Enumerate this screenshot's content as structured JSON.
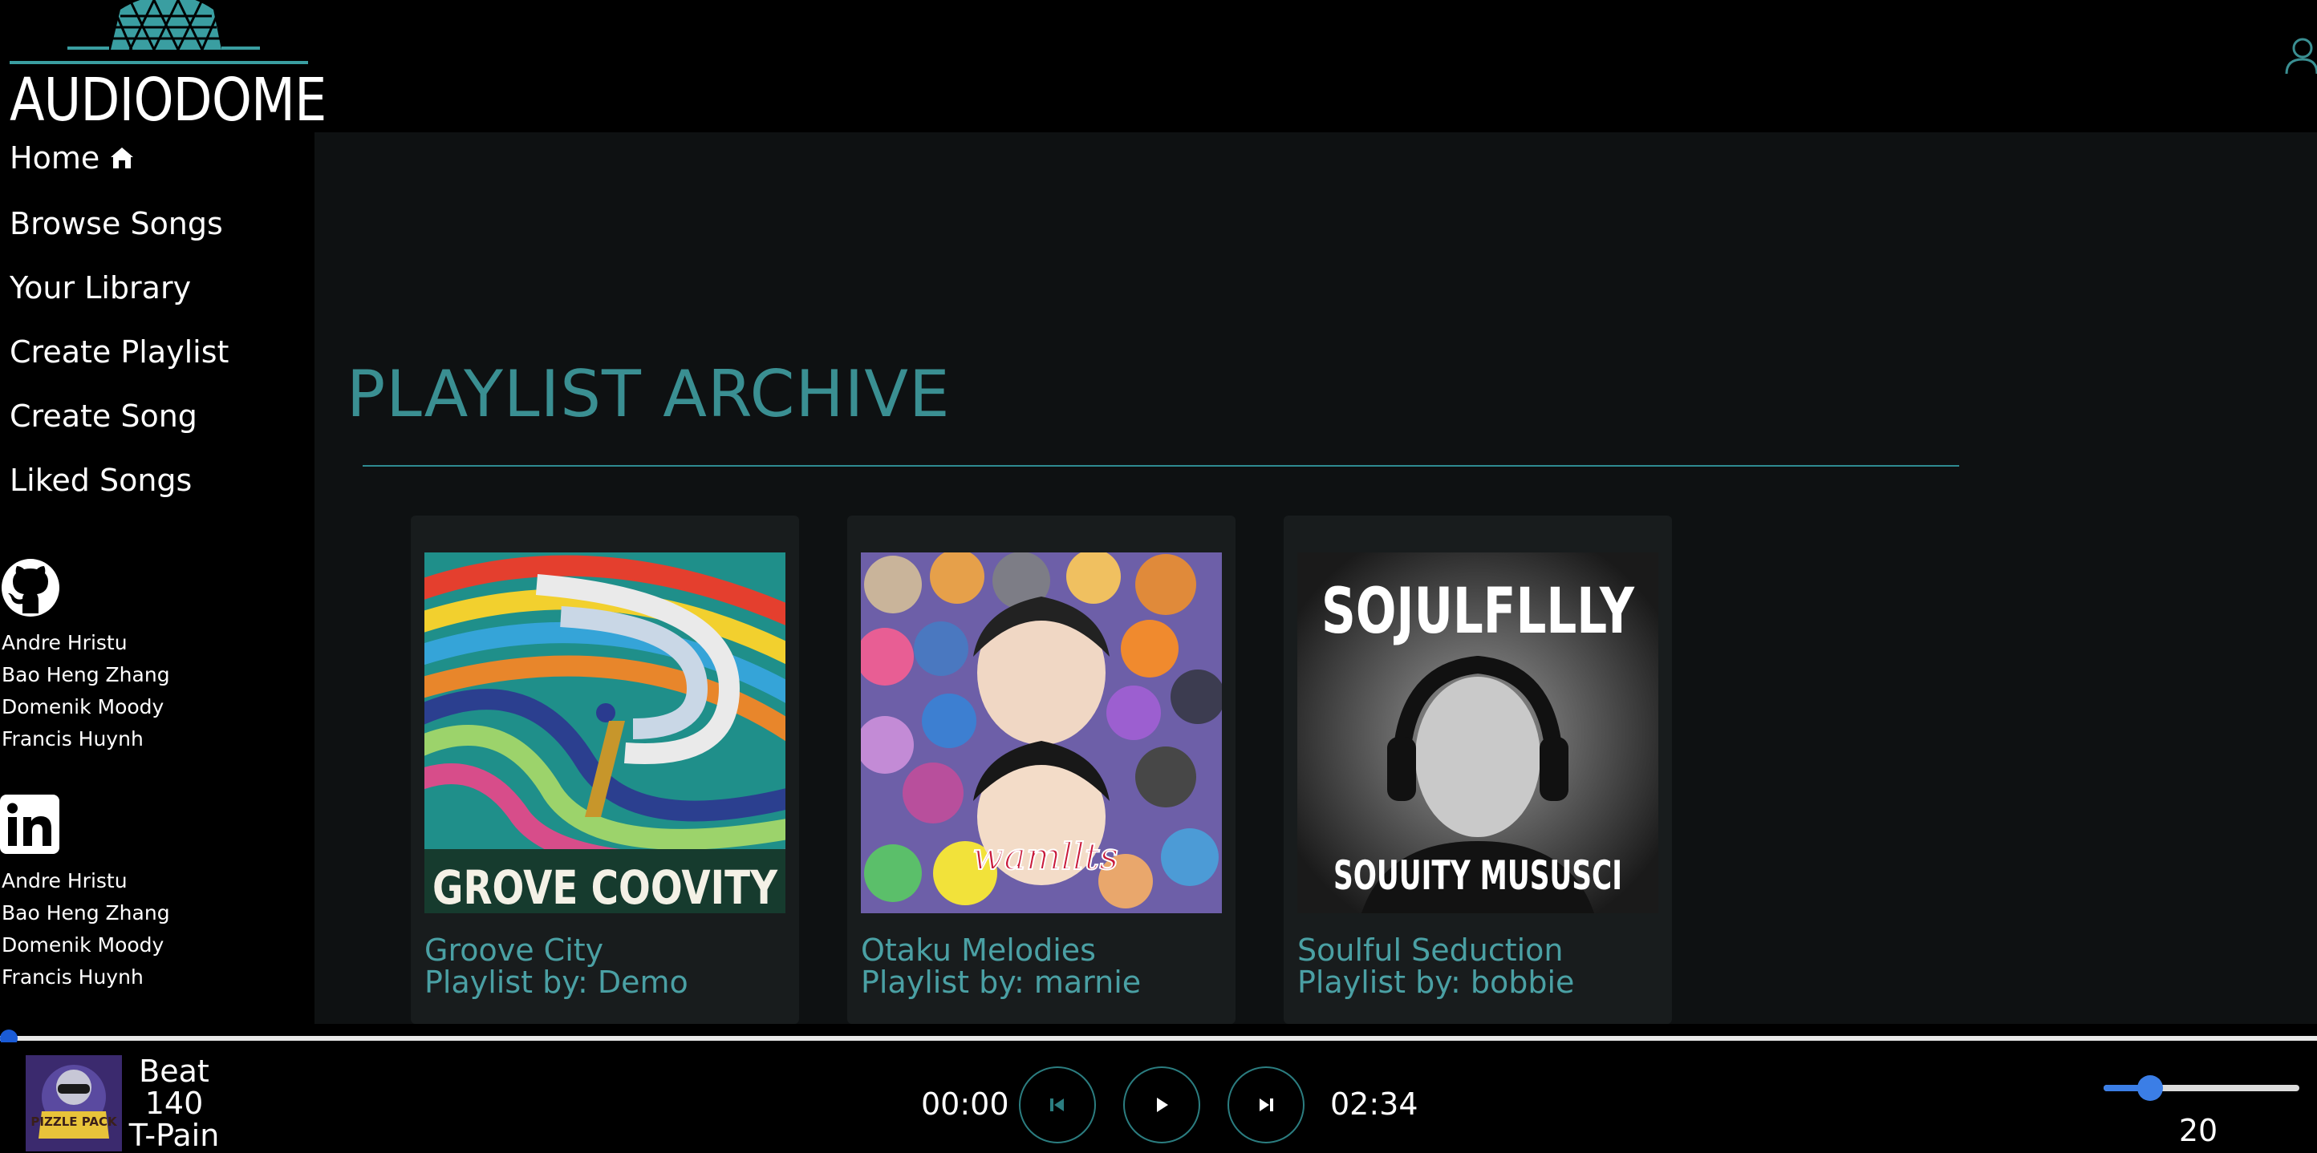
{
  "app": {
    "name": "AUDIODOME",
    "accent": "#3a8f92"
  },
  "nav": {
    "items": [
      {
        "label": "Home",
        "icon": "home-icon"
      },
      {
        "label": "Browse Songs"
      },
      {
        "label": "Your Library"
      },
      {
        "label": "Create Playlist"
      },
      {
        "label": "Create Song"
      },
      {
        "label": "Liked Songs"
      }
    ]
  },
  "credits": {
    "github": {
      "icon": "github-icon",
      "names": [
        "Andre Hristu",
        "Bao Heng Zhang",
        "Domenik Moody",
        "Francis Huynh"
      ]
    },
    "linkedin": {
      "icon": "linkedin-icon",
      "names": [
        "Andre Hristu",
        "Bao Heng Zhang",
        "Domenik Moody",
        "Francis Huynh"
      ]
    }
  },
  "main": {
    "title": "PLAYLIST ARCHIVE",
    "playlists": [
      {
        "title": "Groove City",
        "owner": "Playlist by: Demo",
        "cover_text": "GROVE COOVITY"
      },
      {
        "title": "Otaku Melodies",
        "owner": "Playlist by: marnie",
        "cover_text": "wamllts"
      },
      {
        "title": "Soulful Seduction",
        "owner": "Playlist by: bobbie",
        "cover_text_top": "SOJULFLLLY",
        "cover_text_bottom": "SOUUITY MUSUSCI"
      }
    ]
  },
  "player": {
    "track": {
      "title": "Beat",
      "bpm": "140",
      "artist": "T-Pain",
      "cover_text": "PIZZLE PACK"
    },
    "current_time": "00:00",
    "duration": "02:34",
    "progress": 0,
    "volume": "20",
    "volume_level": 0.2,
    "controls": [
      "skip-back-icon",
      "play-icon",
      "skip-forward-icon"
    ]
  }
}
